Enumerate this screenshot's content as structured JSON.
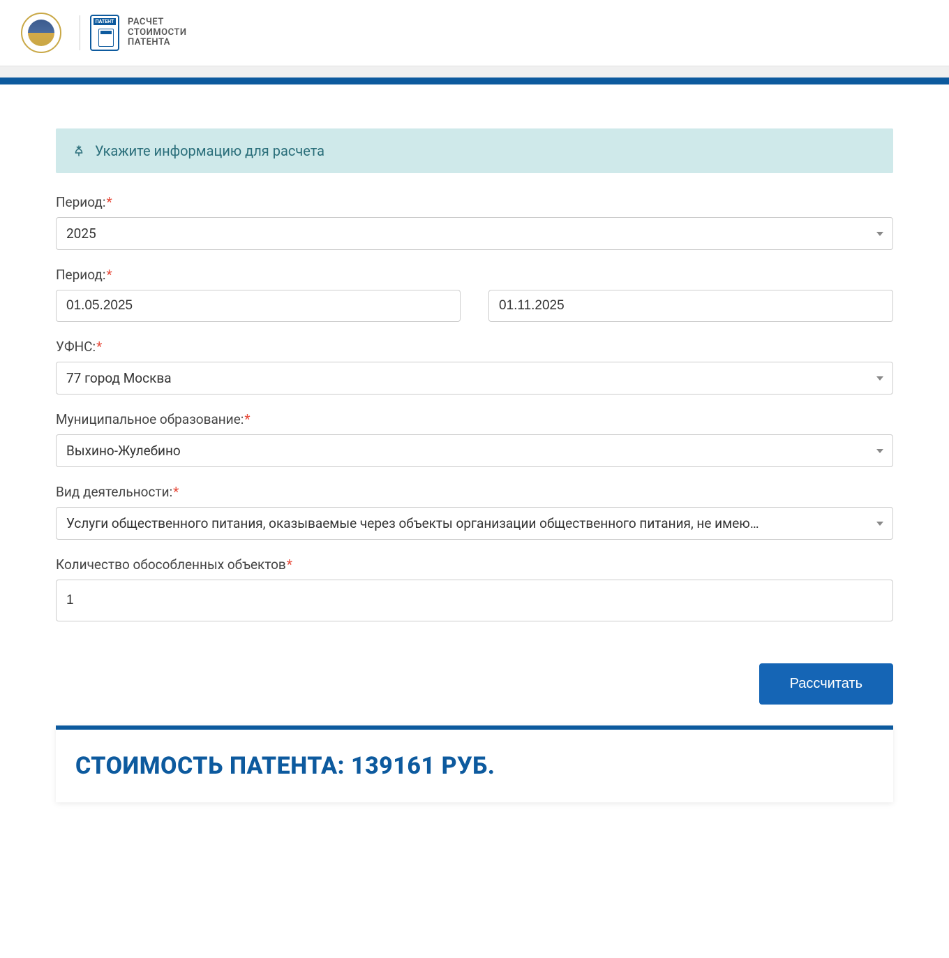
{
  "header": {
    "patent_badge": "ПАТЕНТ",
    "line1": "РАСЧЕТ",
    "line2": "СТОИМОСТИ",
    "line3": "ПАТЕНТА"
  },
  "banner": {
    "text": "Укажите информацию для расчета"
  },
  "form": {
    "period_year": {
      "label": "Период:",
      "value": "2025"
    },
    "period_dates": {
      "label": "Период:",
      "from": "01.05.2025",
      "to": "01.11.2025"
    },
    "ufns": {
      "label": "УФНС:",
      "value": "77 город Москва"
    },
    "municipality": {
      "label": "Муниципальное образование:",
      "value": "Выхино-Жулебино"
    },
    "activity": {
      "label": "Вид деятельности:",
      "value": "Услуги общественного питания, оказываемые через объекты организации общественного питания, не имею…"
    },
    "objects_count": {
      "label": "Количество обособленных объектов",
      "value": "1"
    },
    "submit": "Рассчитать"
  },
  "result": {
    "label_prefix": "СТОИМОСТЬ ПАТЕНТА:",
    "amount": "139161",
    "currency": "РУБ.",
    "full_text": "СТОИМОСТЬ ПАТЕНТА: 139161 РУБ."
  }
}
